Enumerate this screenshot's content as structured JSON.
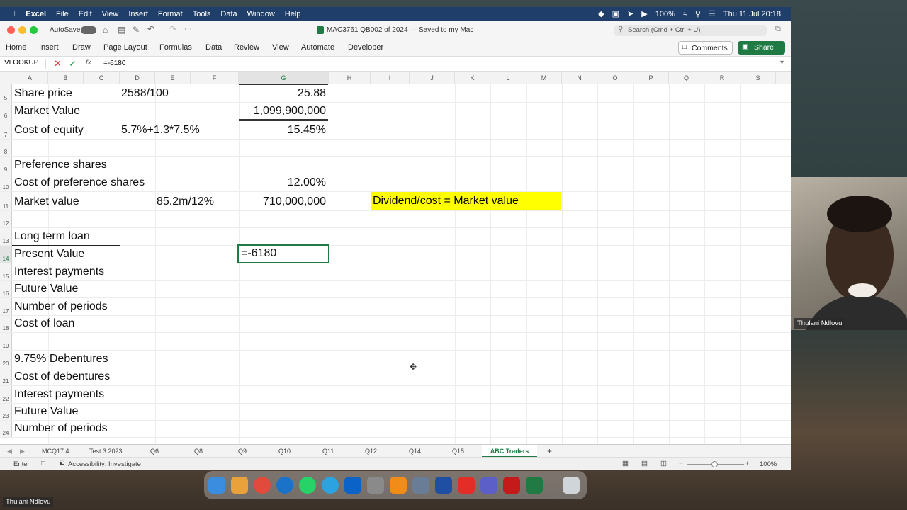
{
  "menubar": {
    "app": "Excel",
    "items": [
      "File",
      "Edit",
      "View",
      "Insert",
      "Format",
      "Tools",
      "Data",
      "Window",
      "Help"
    ],
    "battery": "100%",
    "datetime": "Thu 11 Jul  20:18"
  },
  "titlebar": {
    "autosave": "AutoSave",
    "doc_title": "MAC3761 QB002 of 2024 — Saved to my Mac",
    "search_placeholder": "Search (Cmd + Ctrl + U)"
  },
  "ribbon": {
    "tabs": [
      "Home",
      "Insert",
      "Draw",
      "Page Layout",
      "Formulas",
      "Data",
      "Review",
      "View",
      "Automate",
      "Developer"
    ],
    "comments": "Comments",
    "share": "Share"
  },
  "formula": {
    "namebox": "VLOOKUP",
    "fx": "fx",
    "content": "=-6180"
  },
  "columns": [
    "A",
    "B",
    "C",
    "D",
    "E",
    "F",
    "G",
    "H",
    "I",
    "J",
    "K",
    "L",
    "M",
    "N",
    "O",
    "P",
    "Q",
    "R",
    "S"
  ],
  "rows": [
    {
      "n": "5",
      "a": "Share price",
      "d": "2588/100",
      "g": "25.88"
    },
    {
      "n": "6",
      "a": "Market Value",
      "d": "",
      "g": "1,099,900,000"
    },
    {
      "n": "7",
      "a": "Cost of equity",
      "d": "5.7%+1.3*7.5%",
      "g": "15.45%"
    },
    {
      "n": "8",
      "a": "",
      "d": "",
      "g": ""
    },
    {
      "n": "9",
      "a": "Preference shares",
      "d": "",
      "g": ""
    },
    {
      "n": "10",
      "a": "Cost of preference shares",
      "d": "",
      "g": "12.00%"
    },
    {
      "n": "11",
      "a": "Market value",
      "d": "85.2m/12%",
      "g": "710,000,000"
    },
    {
      "n": "12",
      "a": "",
      "d": "",
      "g": ""
    },
    {
      "n": "13",
      "a": "Long term loan",
      "d": "",
      "g": ""
    },
    {
      "n": "14",
      "a": "Present Value",
      "d": "",
      "g": "=-6180"
    },
    {
      "n": "15",
      "a": "Interest payments",
      "d": "",
      "g": ""
    },
    {
      "n": "16",
      "a": "Future Value",
      "d": "",
      "g": ""
    },
    {
      "n": "17",
      "a": "Number of periods",
      "d": "",
      "g": ""
    },
    {
      "n": "18",
      "a": "Cost of loan",
      "d": "",
      "g": ""
    },
    {
      "n": "19",
      "a": "",
      "d": "",
      "g": ""
    },
    {
      "n": "20",
      "a": "9.75% Debentures",
      "d": "",
      "g": ""
    },
    {
      "n": "21",
      "a": "Cost of debentures",
      "d": "",
      "g": ""
    },
    {
      "n": "22",
      "a": "Interest payments",
      "d": "",
      "g": ""
    },
    {
      "n": "23",
      "a": "Future Value",
      "d": "",
      "g": ""
    },
    {
      "n": "24",
      "a": "Number of periods",
      "d": "",
      "g": ""
    }
  ],
  "note": "Dividend/cost = Market value",
  "sheets": [
    "MCQ17.4",
    "Test 3 2023",
    "Q6",
    "Q8",
    "Q9",
    "Q10",
    "Q11",
    "Q12",
    "Q14",
    "Q15",
    "ABC Traders"
  ],
  "active_sheet": "ABC Traders",
  "status": {
    "mode": "Enter",
    "accessibility": "Accessibility: Investigate",
    "zoom": "100%"
  },
  "participant": "Thulani Ndlovu",
  "colors": {
    "menubar": "#1f3f6a",
    "accent": "#1f7a44",
    "note_bg": "#ffff00"
  }
}
